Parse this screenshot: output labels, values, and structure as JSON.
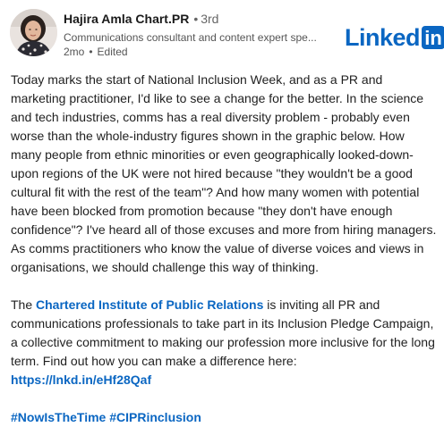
{
  "author": {
    "name": "Hajira Amla Chart.PR",
    "separator": "•",
    "degree": "3rd",
    "headline": "Communications consultant and content expert spe...",
    "time": "2mo",
    "dot": "•",
    "edited": "Edited"
  },
  "brand": {
    "word": "Linked",
    "box": "in"
  },
  "post": {
    "paragraph1": "Today marks the start of National Inclusion Week, and as a PR and marketing practitioner, I'd like to see a change for the better. In the science and tech industries, comms has a real diversity problem - probably even worse than the whole-industry figures shown in the graphic below. How many people from ethnic minorities or even geographically looked-down-upon regions of the UK were not hired because \"they wouldn't be a good cultural fit with the rest of the team\"? And how many women with potential have been blocked from promotion because \"they don't have enough confidence\"? I've heard all of those excuses and more from hiring managers. As comms practitioners who know the value of diverse voices and views in organisations, we should challenge this way of thinking.",
    "p2_prefix": "The ",
    "org_link": "Chartered Institute of Public Relations",
    "p2_suffix": " is inviting all PR and communications professionals to take part in its Inclusion Pledge Campaign, a collective commitment to making our profession more inclusive for the long term. Find out how you can make a difference here:",
    "url": "https://lnkd.in/eHf28Qaf",
    "hashtag1": "#NowIsTheTime",
    "hashtag2": "#CIPRinclusion"
  },
  "colors": {
    "link": "#0a66c2",
    "secondary_text": "#555555",
    "primary_text": "#1f1f1f"
  },
  "icons": {
    "avatar": "profile-photo",
    "brand_logo": "linkedin-logo"
  }
}
